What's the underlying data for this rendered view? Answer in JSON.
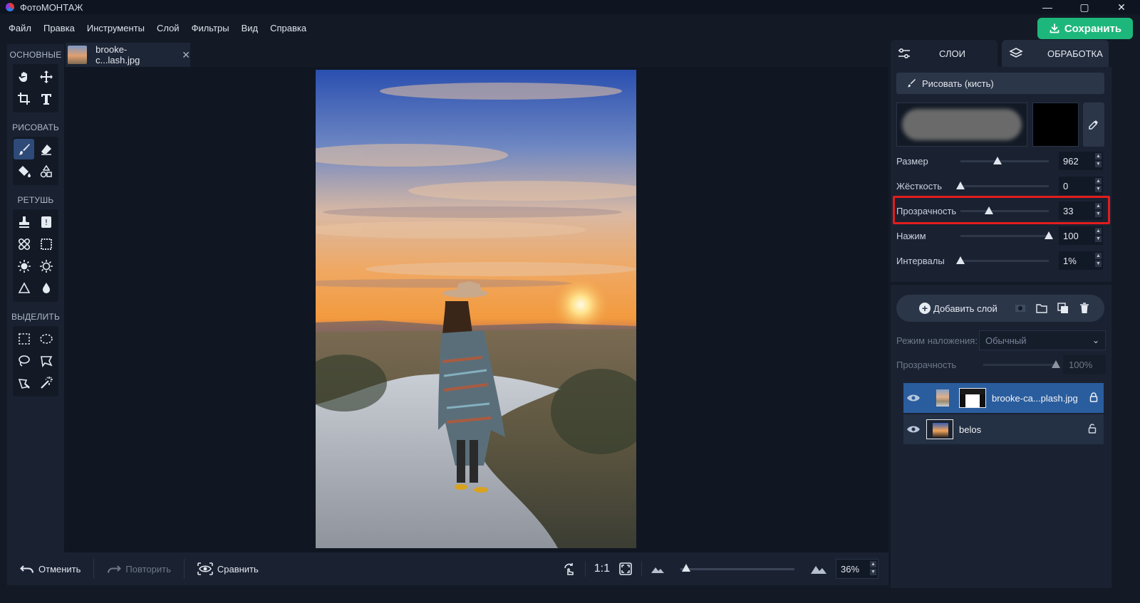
{
  "app": {
    "title": "ФотоМОНТАЖ"
  },
  "window_controls": {
    "minimize": "—",
    "maximize": "▢",
    "close": "✕"
  },
  "menu": [
    "Файл",
    "Правка",
    "Инструменты",
    "Слой",
    "Фильтры",
    "Вид",
    "Справка"
  ],
  "save_button": {
    "label": "Сохранить",
    "color": "#1db77c"
  },
  "toolbar": {
    "groups": [
      {
        "label": "ОСНОВНЫЕ",
        "tools": [
          "hand-icon",
          "move-icon",
          "crop-icon",
          "text-icon"
        ]
      },
      {
        "label": "РИСОВАТЬ",
        "tools": [
          "brush-icon",
          "eraser-icon",
          "fill-bucket-icon",
          "shapes-icon"
        ]
      },
      {
        "label": "РЕТУШЬ",
        "tools": [
          "stamp-icon",
          "patch-icon",
          "healing-icon",
          "frame-icon",
          "sun-icon",
          "sun-outline-icon",
          "triangle-icon",
          "drop-icon"
        ]
      },
      {
        "label": "ВЫДЕЛИТЬ",
        "tools": [
          "rect-select-icon",
          "ellipse-select-icon",
          "lasso-icon",
          "polygon-lasso-icon",
          "magic-lasso-icon",
          "magic-wand-icon"
        ]
      }
    ],
    "active_tool": "brush-icon"
  },
  "document": {
    "tab_name": "brooke-c...lash.jpg",
    "close": "✕"
  },
  "bottom_bar": {
    "undo": "Отменить",
    "redo": "Повторить",
    "compare": "Сравнить",
    "actual_size": "1:1",
    "zoom": "36%"
  },
  "right_panel": {
    "tabs": {
      "layers": "СЛОИ",
      "processing": "ОБРАБОТКА"
    },
    "brush_mode": "Рисовать (кисть)",
    "params": [
      {
        "label": "Размер",
        "value": "962",
        "fraction": 0.42
      },
      {
        "label": "Жёсткость",
        "value": "0",
        "fraction": 0.0
      },
      {
        "label": "Прозрачность",
        "value": "33",
        "fraction": 0.32
      },
      {
        "label": "Нажим",
        "value": "100",
        "fraction": 1.0
      },
      {
        "label": "Интервалы",
        "value": "1%",
        "fraction": 0.0
      }
    ],
    "highlighted_param": "Прозрачность",
    "brush_color": "#000000",
    "add_layer": "Добавить слой",
    "blend": {
      "label": "Режим наложения:",
      "value": "Обычный"
    },
    "layer_opacity": {
      "label": "Прозрачность",
      "value": "100%",
      "fraction": 1.0
    },
    "layers": [
      {
        "name": "brooke-ca...plash.jpg",
        "selected": true,
        "locked": true
      },
      {
        "name": "belos",
        "selected": false,
        "locked": false
      }
    ]
  }
}
